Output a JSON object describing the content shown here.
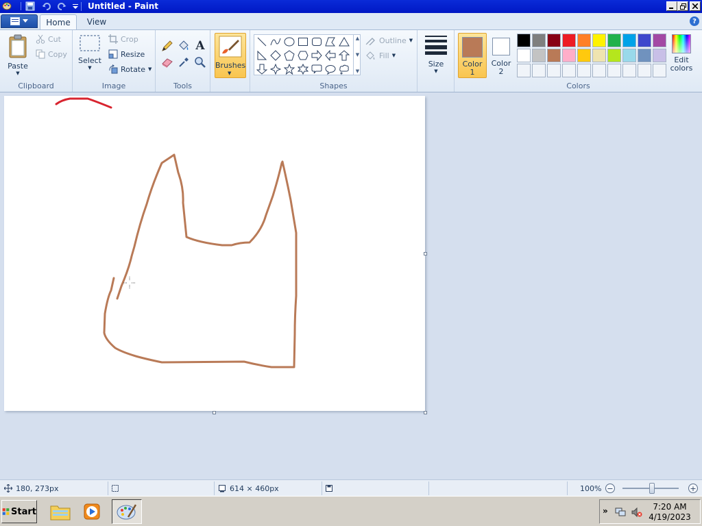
{
  "window": {
    "title": "Untitled - Paint"
  },
  "tabs": [
    {
      "label": "Home"
    },
    {
      "label": "View"
    }
  ],
  "ribbon": {
    "clipboard": {
      "group_label": "Clipboard",
      "paste": "Paste",
      "cut": "Cut",
      "copy": "Copy"
    },
    "image": {
      "group_label": "Image",
      "select": "Select",
      "crop": "Crop",
      "resize": "Resize",
      "rotate": "Rotate"
    },
    "tools": {
      "group_label": "Tools",
      "text_glyph": "A"
    },
    "brushes": {
      "label": "Brushes"
    },
    "shapes": {
      "group_label": "Shapes",
      "outline": "Outline",
      "fill": "Fill"
    },
    "size": {
      "label": "Size"
    },
    "colors": {
      "group_label": "Colors",
      "color1_label": "Color",
      "color1_num": "1",
      "color2_label": "Color",
      "color2_num": "2",
      "color1_value": "#b97a57",
      "color2_value": "#ffffff",
      "edit_colors_line1": "Edit",
      "edit_colors_line2": "colors",
      "palette_row1": [
        "#000000",
        "#7f7f7f",
        "#880015",
        "#ed1c24",
        "#ff7f27",
        "#fff200",
        "#22b14c",
        "#00a2e8",
        "#3f48cc",
        "#a349a4"
      ],
      "palette_row2": [
        "#ffffff",
        "#c3c3c3",
        "#b97a57",
        "#ffaec9",
        "#ffc90e",
        "#efe4b0",
        "#b5e61d",
        "#99d9ea",
        "#7092be",
        "#c8bfe7"
      ],
      "palette_row3": [
        "#f0f4f9",
        "#f0f4f9",
        "#f0f4f9",
        "#f0f4f9",
        "#f0f4f9",
        "#f0f4f9",
        "#f0f4f9",
        "#f0f4f9",
        "#f0f4f9",
        "#f0f4f9"
      ]
    }
  },
  "status": {
    "cursor_pos": "180, 273px",
    "canvas_size": "614 × 460px",
    "zoom": "100%",
    "zoom_out": "−",
    "zoom_in": "+"
  },
  "taskbar": {
    "start": "Start",
    "time": "7:20 AM",
    "date": "4/19/2023",
    "tray_arrow": "»"
  },
  "help": {
    "glyph": "?"
  }
}
